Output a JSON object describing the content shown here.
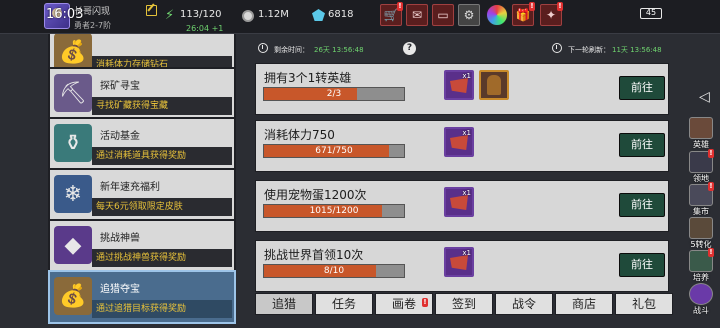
{
  "header": {
    "time": "16:03",
    "player_name": "长哥闪现",
    "player_rank": "勇者2-7阶",
    "stamina": "113/120",
    "stamina_timer": "26:04 +1",
    "gold": "1.12M",
    "gems": "6818",
    "battery": "45"
  },
  "events": [
    {
      "title": "",
      "subtitle": "消耗体力存储钻石",
      "icon": "treasure-chest-icon"
    },
    {
      "title": "探矿寻宝",
      "subtitle": "寻找矿藏获得宝藏",
      "icon": "mine-cart-icon"
    },
    {
      "title": "活动基金",
      "subtitle": "通过消耗道具获得奖励",
      "icon": "fund-pot-icon"
    },
    {
      "title": "新年速充福利",
      "subtitle": "每天6元领取限定皮肤",
      "icon": "crystal-icon"
    },
    {
      "title": "挑战神兽",
      "subtitle": "通过挑战神兽获得奖励",
      "icon": "beast-icon"
    },
    {
      "title": "追猎夺宝",
      "subtitle": "通过追猎目标获得奖励",
      "icon": "treasure-chest-icon",
      "active": true
    }
  ],
  "timer_bar": {
    "remaining_label": "剩余时间：",
    "remaining_value": "26天 13:56:48",
    "next_refresh_label": "下一轮刷新：",
    "next_refresh_value": "11天 13:56:48"
  },
  "quests": [
    {
      "title": "拥有3个1转英雄",
      "progress": "2/3",
      "current": 2,
      "target": 3,
      "rewards": [
        {
          "icon": "red-gem-icon",
          "count": "x1"
        },
        {
          "icon": "hero-card-icon",
          "count": ""
        }
      ]
    },
    {
      "title": "消耗体力750",
      "progress": "671/750",
      "current": 671,
      "target": 750,
      "rewards": [
        {
          "icon": "red-gem-icon",
          "count": "x1"
        }
      ]
    },
    {
      "title": "使用宠物蛋1200次",
      "progress": "1015/1200",
      "current": 1015,
      "target": 1200,
      "rewards": [
        {
          "icon": "red-gem-icon",
          "count": "x1"
        }
      ]
    },
    {
      "title": "挑战世界首领10次",
      "progress": "8/10",
      "current": 8,
      "target": 10,
      "rewards": [
        {
          "icon": "red-gem-icon",
          "count": "x1"
        }
      ]
    }
  ],
  "goto_label": "前往",
  "tabs": [
    "追猎",
    "任务",
    "画卷",
    "签到",
    "战令",
    "商店",
    "礼包"
  ],
  "side_menu": [
    {
      "label": "英雄",
      "icon": "hero-icon"
    },
    {
      "label": "领地",
      "icon": "territory-icon"
    },
    {
      "label": "集市",
      "icon": "market-icon"
    },
    {
      "label": "5转化",
      "icon": "transform-icon"
    },
    {
      "label": "培养",
      "icon": "train-icon"
    },
    {
      "label": "战斗",
      "icon": "battle-icon"
    }
  ],
  "colors": {
    "progress_fill": "#c8572a",
    "goto_button": "#1f4a3a",
    "alert": "#e03030",
    "active_event": "#4a6c8e",
    "subtitle_text": "#e8c23a"
  }
}
